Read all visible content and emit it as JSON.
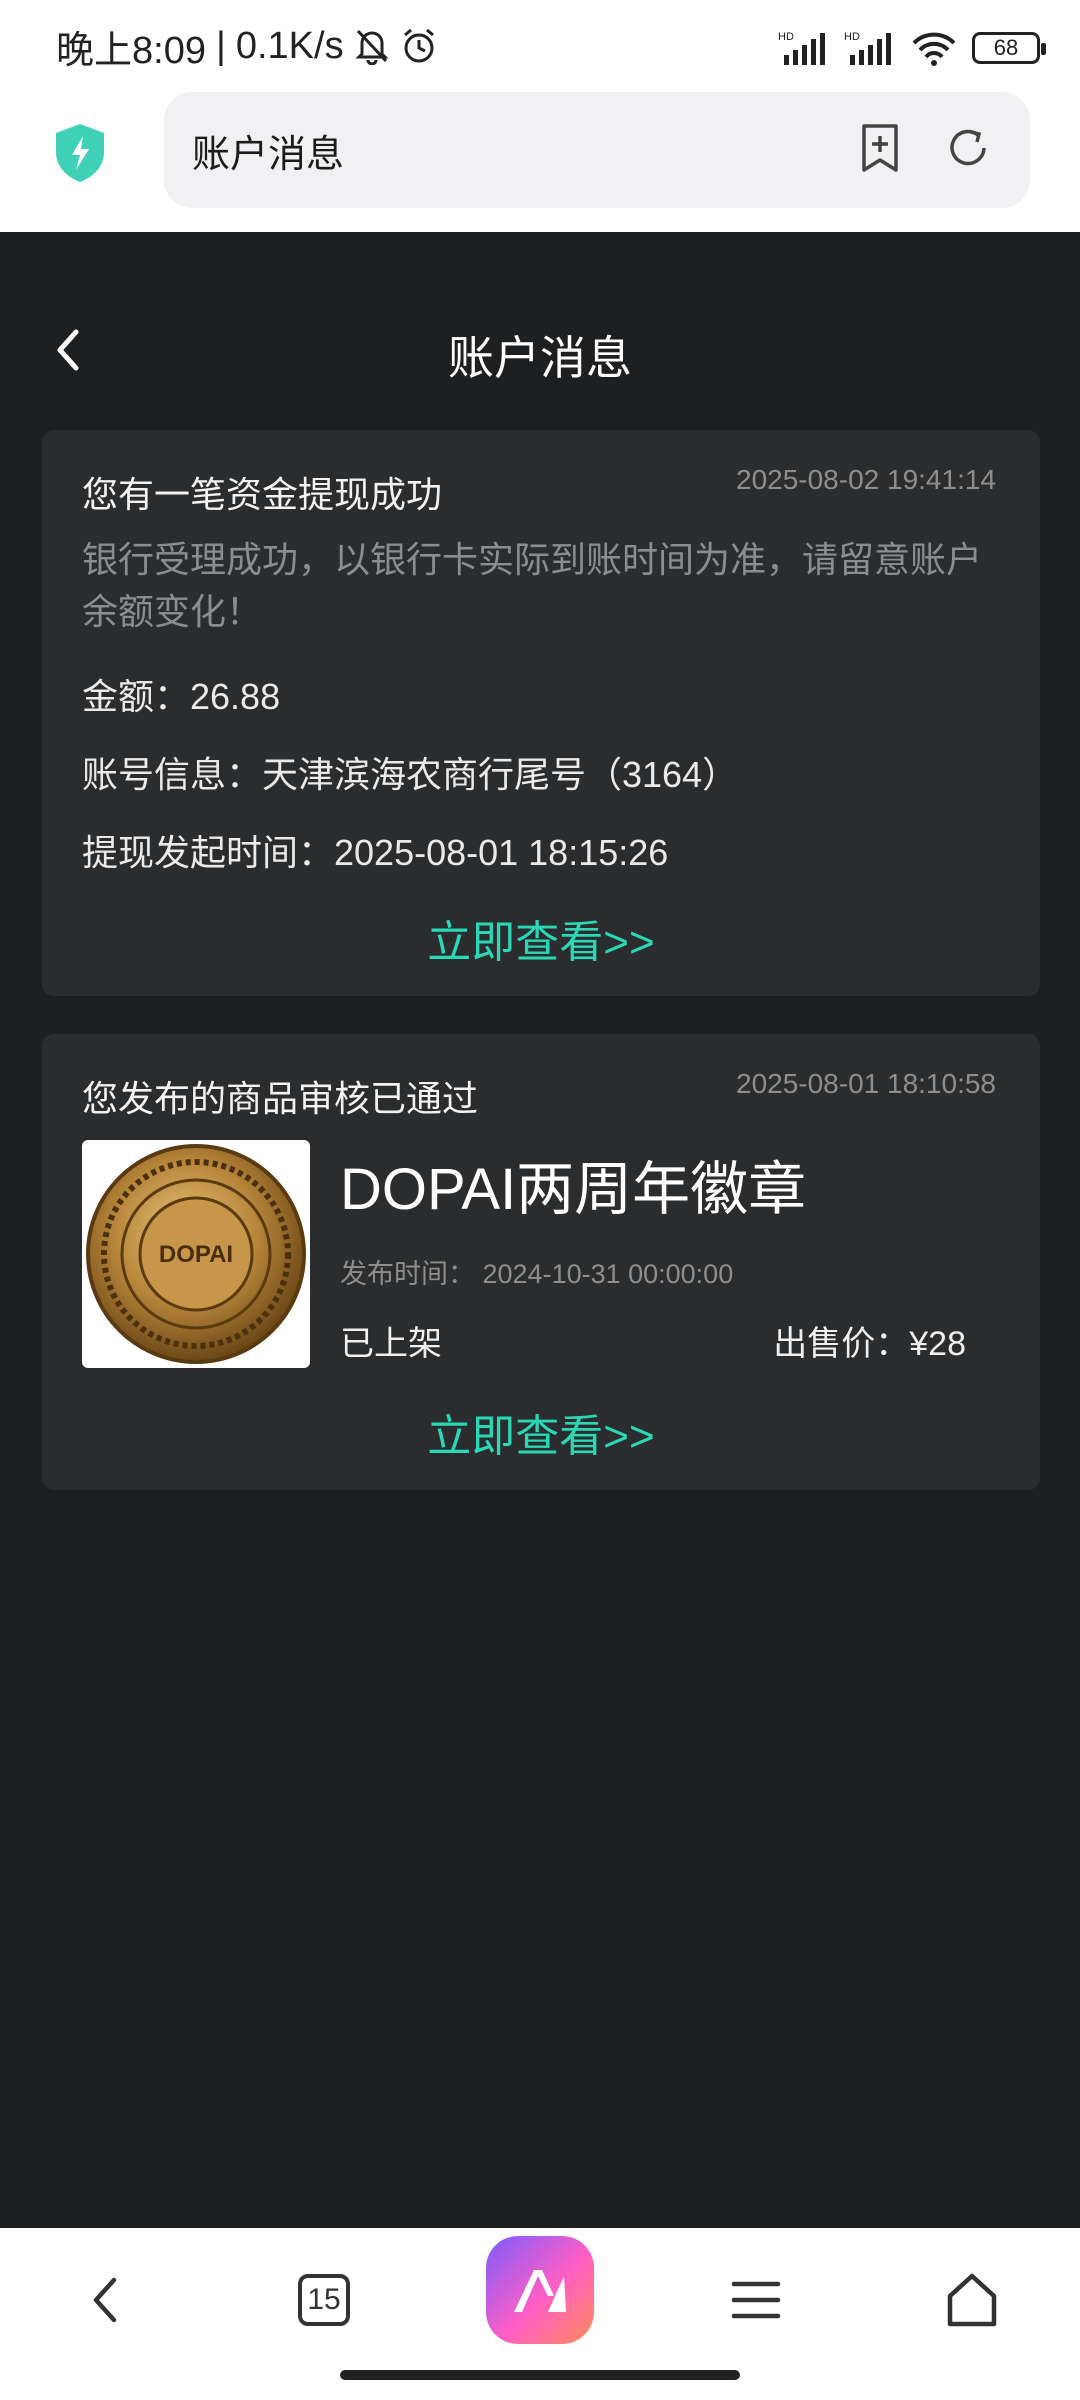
{
  "status_bar": {
    "time": "晚上8:09",
    "network_speed": "0.1K/s",
    "battery": "68",
    "signal_label_1": "HD",
    "signal_label_2": "HD"
  },
  "browser": {
    "address_text": "账户消息"
  },
  "header": {
    "title": "账户消息"
  },
  "messages": [
    {
      "title": "您有一笔资金提现成功",
      "time": "2025-08-02 19:41:14",
      "description": "银行受理成功，以银行卡实际到账时间为准，请留意账户余额变化！",
      "amount": "金额：26.88",
      "account": "账号信息：天津滨海农商行尾号（3164）",
      "initiated": "提现发起时间：2025-08-01 18:15:26",
      "link": "立即查看>>"
    },
    {
      "title": "您发布的商品审核已通过",
      "time": "2025-08-01 18:10:58",
      "product_name": "DOPAI两周年徽章",
      "publish_date": "发布时间： 2024-10-31 00:00:00",
      "status": "已上架",
      "price": "出售价：¥28",
      "badge_text": "DOPAI",
      "link": "立即查看>>"
    }
  ],
  "bottom_nav": {
    "tab_count": "15"
  },
  "colors": {
    "accent": "#2ad8b7",
    "background": "#1d1f21",
    "card": "#2a2c2e"
  }
}
